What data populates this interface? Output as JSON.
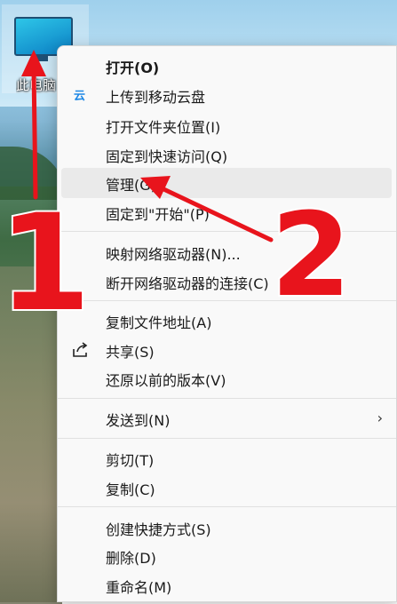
{
  "desktop": {
    "icon_label": "此电脑"
  },
  "menu": {
    "items": [
      {
        "label": "打开(O)"
      },
      {
        "label": "上传到移动云盘",
        "icon": "cloud-upload-icon"
      },
      {
        "label": "打开文件夹位置(I)"
      },
      {
        "label": "固定到快速访问(Q)"
      },
      {
        "label": "管理(G)"
      },
      {
        "label": "固定到\"开始\"(P)"
      },
      {
        "label": "映射网络驱动器(N)..."
      },
      {
        "label": "断开网络驱动器的连接(C)"
      },
      {
        "label": "复制文件地址(A)"
      },
      {
        "label": "共享(S)",
        "icon": "share-icon"
      },
      {
        "label": "还原以前的版本(V)"
      },
      {
        "label": "发送到(N)",
        "icon": "chevron-right-icon"
      },
      {
        "label": "剪切(T)"
      },
      {
        "label": "复制(C)"
      },
      {
        "label": "创建快捷方式(S)"
      },
      {
        "label": "删除(D)"
      },
      {
        "label": "重命名(M)"
      }
    ]
  },
  "annotations": {
    "step1": "1",
    "step2": "2",
    "color": "#e8141c"
  }
}
